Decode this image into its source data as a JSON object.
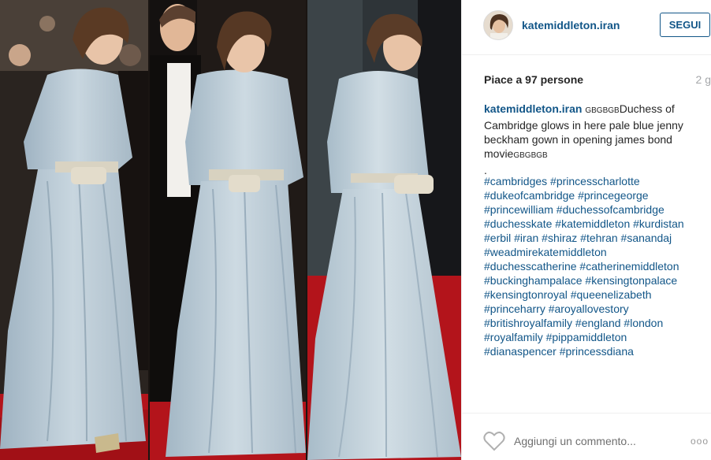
{
  "post": {
    "username": "katemiddleton.iran",
    "follow_label": "SEGUI",
    "likes_text": "Piace a 97 persone",
    "timestamp": "2 g",
    "caption_user": "katemiddleton.iran",
    "caption_prefix": "GBGBGB",
    "caption_text": "Duchess of Cambridge glows in here pale blue jenny beckham gown in opening james bond movie",
    "caption_suffix": "GBGBGB",
    "caption_dot": ".",
    "hashtag_lines": [
      "#cambridges #princesscharlotte",
      "#dukeofcambridge #princegeorge",
      "#princewilliam #duchessofcambridge",
      "#duchesskate #katemiddleton #kurdistan",
      "#erbil #iran #shiraz #tehran #sanandaj",
      "#weadmirekatemiddleton",
      "#duchesscatherine #catherinemiddleton",
      "#buckinghampalace #kensingtonpalace",
      "#kensingtonroyal #queenelizabeth",
      "#princeharry #aroyallovestory",
      "#britishroyalfamily #england #london",
      "#royalfamily #pippamiddleton",
      "#dianaspencer #princessdiana"
    ],
    "comment_placeholder": "Aggiungi un commento...",
    "more_label": "ooo"
  },
  "icons": {
    "heart": "heart-outline-icon",
    "more": "more-options-icon",
    "avatar": "profile-avatar"
  },
  "colors": {
    "link_blue": "#125688",
    "timestamp_gray": "#a5a7aa",
    "gown_blue": "#b4c6d2",
    "carpet_red": "#b3141b"
  }
}
